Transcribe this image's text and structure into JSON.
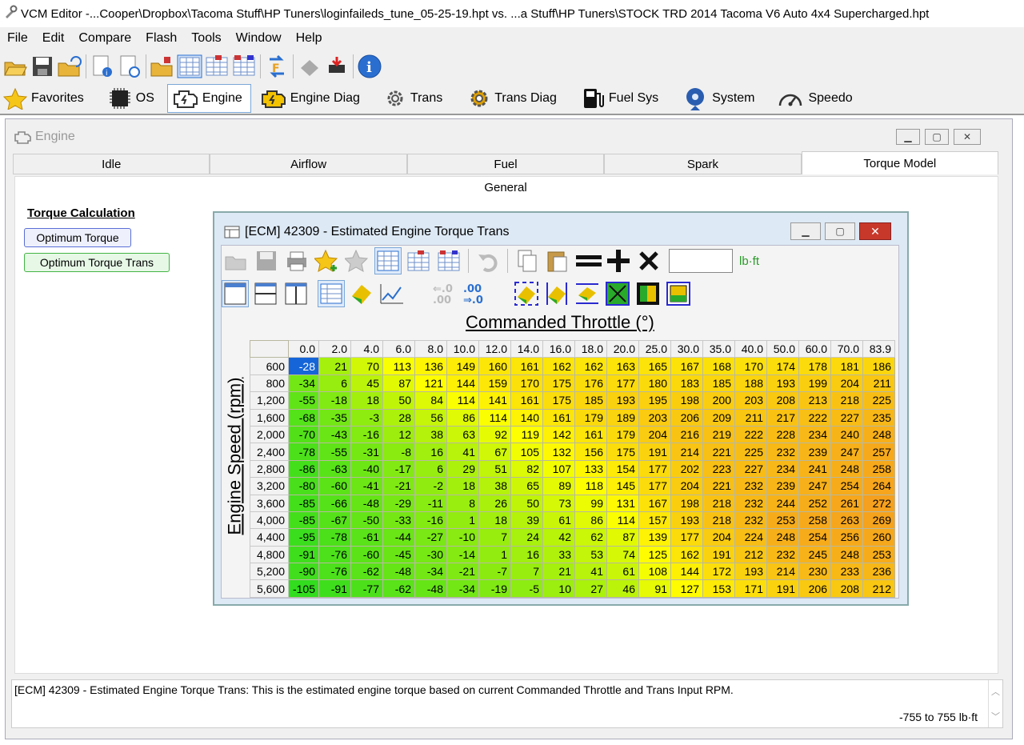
{
  "app": {
    "title": "VCM Editor -...Cooper\\Dropbox\\Tacoma Stuff\\HP Tuners\\loginfaileds_tune_05-25-19.hpt vs. ...a Stuff\\HP Tuners\\STOCK TRD 2014 Tacoma V6 Auto 4x4 Supercharged.hpt"
  },
  "menu": [
    "File",
    "Edit",
    "Compare",
    "Flash",
    "Tools",
    "Window",
    "Help"
  ],
  "toolbar1_icons": [
    "open-icon",
    "save-icon",
    "open-recent-icon",
    "file-info-icon",
    "file-history-icon",
    "open-compare-icon",
    "table-icon",
    "table-compare-icon",
    "table-diff-icon",
    "convert-icon",
    "flash-read-icon",
    "flash-write-icon",
    "info-icon"
  ],
  "nav_tabs": [
    {
      "label": "Favorites",
      "icon": "star-icon"
    },
    {
      "label": "OS",
      "icon": "chip-icon"
    },
    {
      "label": "Engine",
      "icon": "engine-icon",
      "selected": true
    },
    {
      "label": "Engine Diag",
      "icon": "engine-diag-icon"
    },
    {
      "label": "Trans",
      "icon": "gear-icon"
    },
    {
      "label": "Trans Diag",
      "icon": "gear-diag-icon"
    },
    {
      "label": "Fuel Sys",
      "icon": "fuel-pump-icon"
    },
    {
      "label": "System",
      "icon": "system-icon"
    },
    {
      "label": "Speedo",
      "icon": "speedometer-icon"
    }
  ],
  "engine_window": {
    "title": "Engine",
    "tabs": [
      "Idle",
      "Airflow",
      "Fuel",
      "Spark",
      "Torque Model"
    ],
    "selected_tab": "Torque Model",
    "subheader": "General",
    "section_title": "Torque Calculation",
    "buttons": [
      "Optimum Torque",
      "Optimum Torque Trans"
    ]
  },
  "table_window": {
    "title": "[ECM] 42309 - Estimated Engine Torque Trans",
    "units": "lb·ft",
    "input_value": "",
    "col_axis_label": "Commanded Throttle (°)",
    "row_axis_label": "Engine Speed (rpm)",
    "columns": [
      "0.0",
      "2.0",
      "4.0",
      "6.0",
      "8.0",
      "10.0",
      "12.0",
      "14.0",
      "16.0",
      "18.0",
      "20.0",
      "25.0",
      "30.0",
      "35.0",
      "40.0",
      "50.0",
      "60.0",
      "70.0",
      "83.9"
    ],
    "rows": [
      {
        "rpm": "600",
        "values": [
          -28,
          21,
          70,
          113,
          136,
          149,
          160,
          161,
          162,
          162,
          163,
          165,
          167,
          168,
          170,
          174,
          178,
          181,
          186
        ]
      },
      {
        "rpm": "800",
        "values": [
          -34,
          6,
          45,
          87,
          121,
          144,
          159,
          170,
          175,
          176,
          177,
          180,
          183,
          185,
          188,
          193,
          199,
          204,
          211
        ]
      },
      {
        "rpm": "1,200",
        "values": [
          -55,
          -18,
          18,
          50,
          84,
          114,
          141,
          161,
          175,
          185,
          193,
          195,
          198,
          200,
          203,
          208,
          213,
          218,
          225
        ]
      },
      {
        "rpm": "1,600",
        "values": [
          -68,
          -35,
          -3,
          28,
          56,
          86,
          114,
          140,
          161,
          179,
          189,
          203,
          206,
          209,
          211,
          217,
          222,
          227,
          235
        ]
      },
      {
        "rpm": "2,000",
        "values": [
          -70,
          -43,
          -16,
          12,
          38,
          63,
          92,
          119,
          142,
          161,
          179,
          204,
          216,
          219,
          222,
          228,
          234,
          240,
          248
        ]
      },
      {
        "rpm": "2,400",
        "values": [
          -78,
          -55,
          -31,
          -8,
          16,
          41,
          67,
          105,
          132,
          156,
          175,
          191,
          214,
          221,
          225,
          232,
          239,
          247,
          257
        ]
      },
      {
        "rpm": "2,800",
        "values": [
          -86,
          -63,
          -40,
          -17,
          6,
          29,
          51,
          82,
          107,
          133,
          154,
          177,
          202,
          223,
          227,
          234,
          241,
          248,
          258
        ]
      },
      {
        "rpm": "3,200",
        "values": [
          -80,
          -60,
          -41,
          -21,
          -2,
          18,
          38,
          65,
          89,
          118,
          145,
          177,
          204,
          221,
          232,
          239,
          247,
          254,
          264
        ]
      },
      {
        "rpm": "3,600",
        "values": [
          -85,
          -66,
          -48,
          -29,
          -11,
          8,
          26,
          50,
          73,
          99,
          131,
          167,
          198,
          218,
          232,
          244,
          252,
          261,
          272
        ]
      },
      {
        "rpm": "4,000",
        "values": [
          -85,
          -67,
          -50,
          -33,
          -16,
          1,
          18,
          39,
          61,
          86,
          114,
          157,
          193,
          218,
          232,
          253,
          258,
          263,
          269
        ]
      },
      {
        "rpm": "4,400",
        "values": [
          -95,
          -78,
          -61,
          -44,
          -27,
          -10,
          7,
          24,
          42,
          62,
          87,
          139,
          177,
          204,
          224,
          248,
          254,
          256,
          260
        ]
      },
      {
        "rpm": "4,800",
        "values": [
          -91,
          -76,
          -60,
          -45,
          -30,
          -14,
          1,
          16,
          33,
          53,
          74,
          125,
          162,
          191,
          212,
          232,
          245,
          248,
          253
        ]
      },
      {
        "rpm": "5,200",
        "values": [
          -90,
          -76,
          -62,
          -48,
          -34,
          -21,
          -7,
          7,
          21,
          41,
          61,
          108,
          144,
          172,
          193,
          214,
          230,
          233,
          236
        ]
      },
      {
        "rpm": "5,600",
        "values": [
          -105,
          -91,
          -77,
          -62,
          -48,
          -34,
          -19,
          -5,
          10,
          27,
          46,
          91,
          127,
          153,
          171,
          191,
          206,
          208,
          212
        ]
      }
    ],
    "selected_cell": {
      "row": 0,
      "col": 0
    }
  },
  "status": {
    "description": "[ECM] 42309 - Estimated Engine Torque Trans: This is the estimated engine torque based on current Commanded Throttle and Trans Input RPM.",
    "range": "-755 to 755 lb·ft"
  },
  "colors": {
    "low": "#33dd22",
    "mid": "#ffff00",
    "high": "#f5a623",
    "selected": "#1565d8"
  }
}
